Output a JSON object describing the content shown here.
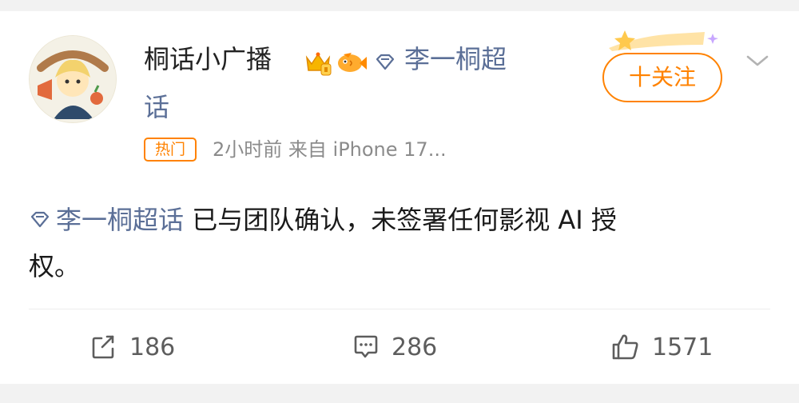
{
  "post": {
    "username": "桐话小广播",
    "super_topic_link_part1": "李一桐超",
    "super_topic_link_part2": "话",
    "hot_tag": "热门",
    "meta": "2小时前  来自 iPhone 17...",
    "follow_label": "十关注",
    "text_link": "李一桐超话",
    "text_body_line1": " 已与团队确认，未签署任何影视 AI 授",
    "text_body_line2": "权。"
  },
  "actions": {
    "repost_count": "186",
    "comment_count": "286",
    "like_count": "1571"
  },
  "icons": {
    "vip": "crown-badge-icon",
    "fish": "fish-badge-icon",
    "super_topic": "diamond-icon",
    "chevron": "chevron-down-icon",
    "repost": "repost-icon",
    "comment": "comment-icon",
    "like": "thumbs-up-icon"
  },
  "colors": {
    "accent_orange": "#ff8200",
    "link_blue": "#5b6f97",
    "meta_gray": "#8b8b8b"
  }
}
